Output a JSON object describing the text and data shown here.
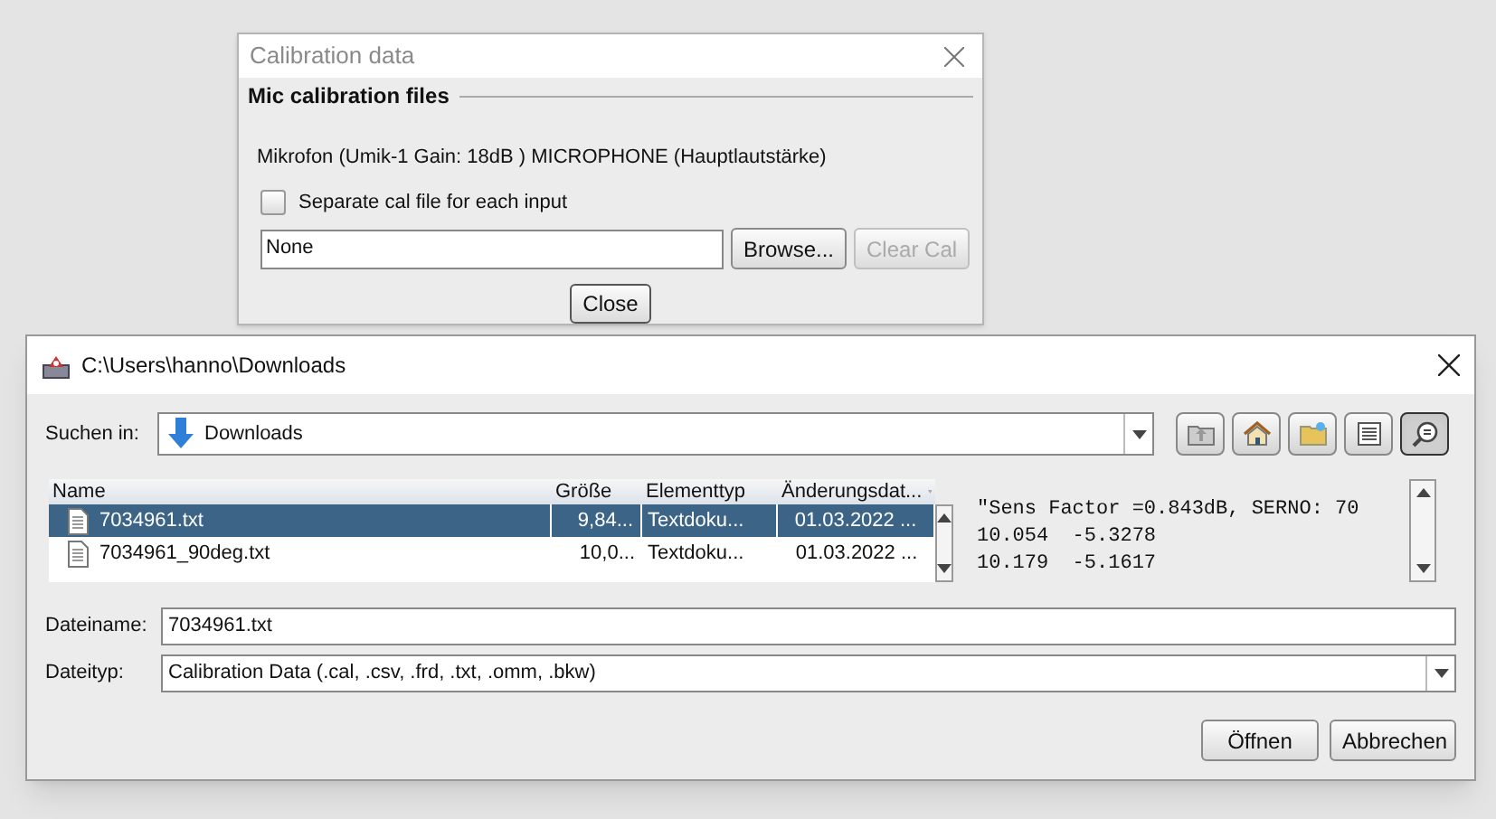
{
  "calibration_dialog": {
    "title": "Calibration data",
    "group_title": "Mic calibration files",
    "device_label": "Mikrofon (Umik-1  Gain: 18dB  ) MICROPHONE (Hauptlautstärke)",
    "separate_cal": {
      "label": "Separate cal file for each input",
      "checked": false
    },
    "file_field": {
      "value": "None"
    },
    "buttons": [
      {
        "label": "Browse...",
        "disabled": false
      },
      {
        "label": "Clear Cal",
        "disabled": true
      }
    ],
    "close_button": {
      "label": "Close"
    }
  },
  "file_dialog": {
    "title": "C:\\Users\\hanno\\Downloads",
    "look_in": {
      "label": "Suchen in:",
      "value": "Downloads"
    },
    "view_buttons": [
      {
        "kind": "list",
        "selected": false
      },
      {
        "kind": "details",
        "selected": true
      }
    ],
    "columns": [
      "Name",
      "Größe",
      "Elementtyp",
      "Änderungsdat..."
    ],
    "rows": [
      {
        "name": "7034961.txt",
        "size": "9,84...",
        "type": "Textdoku...",
        "date": "01.03.2022 ...",
        "selected": true
      },
      {
        "name": "7034961_90deg.txt",
        "size": "10,0...",
        "type": "Textdoku...",
        "date": "01.03.2022 ...",
        "selected": false
      }
    ],
    "preview_lines": [
      "\"Sens Factor =0.843dB, SERNO: 70",
      "10.054  -5.3278",
      "10.179  -5.1617"
    ],
    "filename": {
      "label": "Dateiname:",
      "value": "7034961.txt"
    },
    "filetype": {
      "label": "Dateityp:",
      "value": "Calibration Data (.cal, .csv, .frd, .txt, .omm, .bkw)"
    },
    "buttons": [
      {
        "label": "Öffnen"
      },
      {
        "label": "Abbrechen"
      }
    ]
  }
}
